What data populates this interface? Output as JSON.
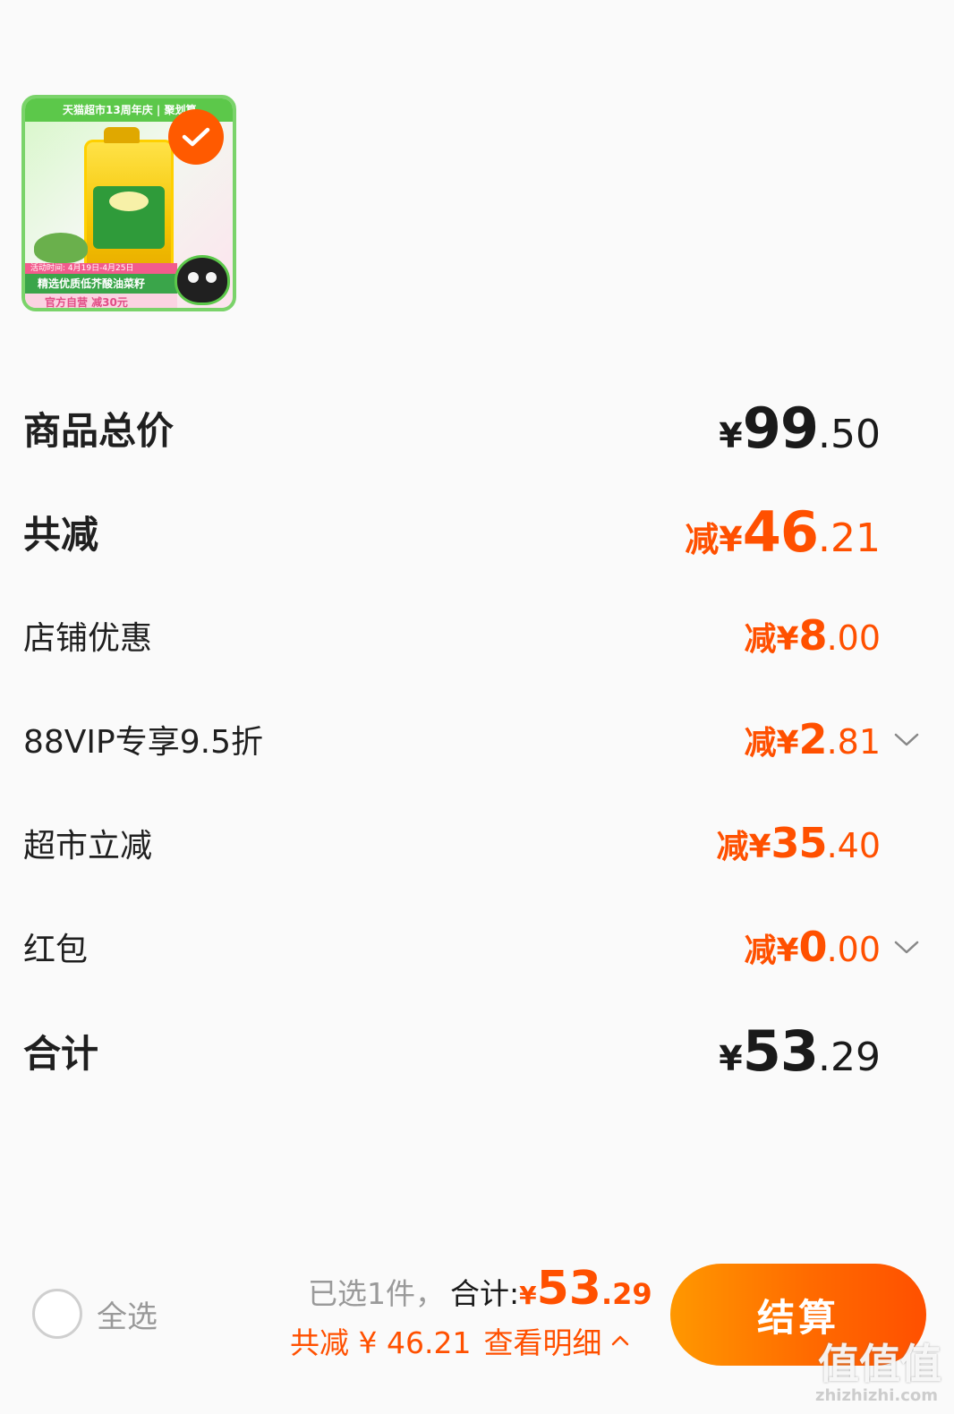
{
  "product": {
    "banner_text": "天猫超市13周年庆 | 聚划算",
    "promo_date": "活动时间: 4月19日-4月25日",
    "promo_title": "精选优质低芥酸油菜籽",
    "promo_discount": "官方自营 减30元",
    "selected": true
  },
  "rows": {
    "goods_total": {
      "label": "商品总价",
      "currency": "¥",
      "int": "99",
      "dec": ".50"
    },
    "total_discount": {
      "label": "共减",
      "prefix": "减¥",
      "int": "46",
      "dec": ".21"
    },
    "shop_discount": {
      "label": "店铺优惠",
      "prefix": "减¥",
      "int": "8",
      "dec": ".00"
    },
    "vip_discount": {
      "label": "88VIP专享9.5折",
      "prefix": "减¥",
      "int": "2",
      "dec": ".81"
    },
    "market_discount": {
      "label": "超市立减",
      "prefix": "减¥",
      "int": "35",
      "dec": ".40"
    },
    "red_packet": {
      "label": "红包",
      "prefix": "减¥",
      "int": "0",
      "dec": ".00"
    },
    "grand_total": {
      "label": "合计",
      "currency": "¥",
      "int": "53",
      "dec": ".29"
    }
  },
  "bottom_bar": {
    "select_all": "全选",
    "selected_count": "已选1件，",
    "total_label": "合计:",
    "total_currency": "¥",
    "total_int": "53",
    "total_dec": ".29",
    "discount_text": "共减 ¥ 46.21",
    "details_link": "查看明细",
    "checkout_label": "结算"
  },
  "watermark": {
    "text": "值值值",
    "url": "zhizhizhi.com"
  },
  "colors": {
    "accent": "#ff5000",
    "text": "#1a1a1a",
    "muted": "#999999"
  }
}
